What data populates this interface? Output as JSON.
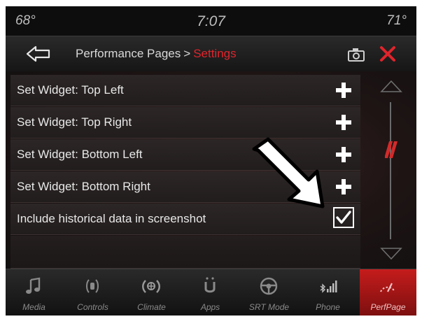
{
  "status": {
    "temp_left": "68°",
    "time": "7:07",
    "temp_right": "71°"
  },
  "header": {
    "breadcrumb_parent": "Performance Pages",
    "breadcrumb_sep": ">",
    "breadcrumb_current": "Settings",
    "accent_color": "#e0242c"
  },
  "settings": {
    "rows": [
      {
        "label": "Set Widget: Top Left",
        "control": "plus-icon"
      },
      {
        "label": "Set Widget: Top Right",
        "control": "plus-icon"
      },
      {
        "label": "Set Widget: Bottom Left",
        "control": "plus-icon"
      },
      {
        "label": "Set Widget: Bottom Right",
        "control": "plus-icon"
      },
      {
        "label": "Include historical data in screenshot",
        "control": "checkbox",
        "checked": true
      }
    ]
  },
  "nav": {
    "items": [
      {
        "label": "Media",
        "icon": "music-note-icon"
      },
      {
        "label": "Controls",
        "icon": "controls-icon"
      },
      {
        "label": "Climate",
        "icon": "climate-icon"
      },
      {
        "label": "Apps",
        "icon": "apps-icon"
      },
      {
        "label": "SRT Mode",
        "icon": "steering-wheel-icon"
      },
      {
        "label": "Phone",
        "icon": "phone-signal-icon"
      },
      {
        "label": "PerfPage",
        "icon": "performance-icon",
        "active": true
      }
    ]
  }
}
